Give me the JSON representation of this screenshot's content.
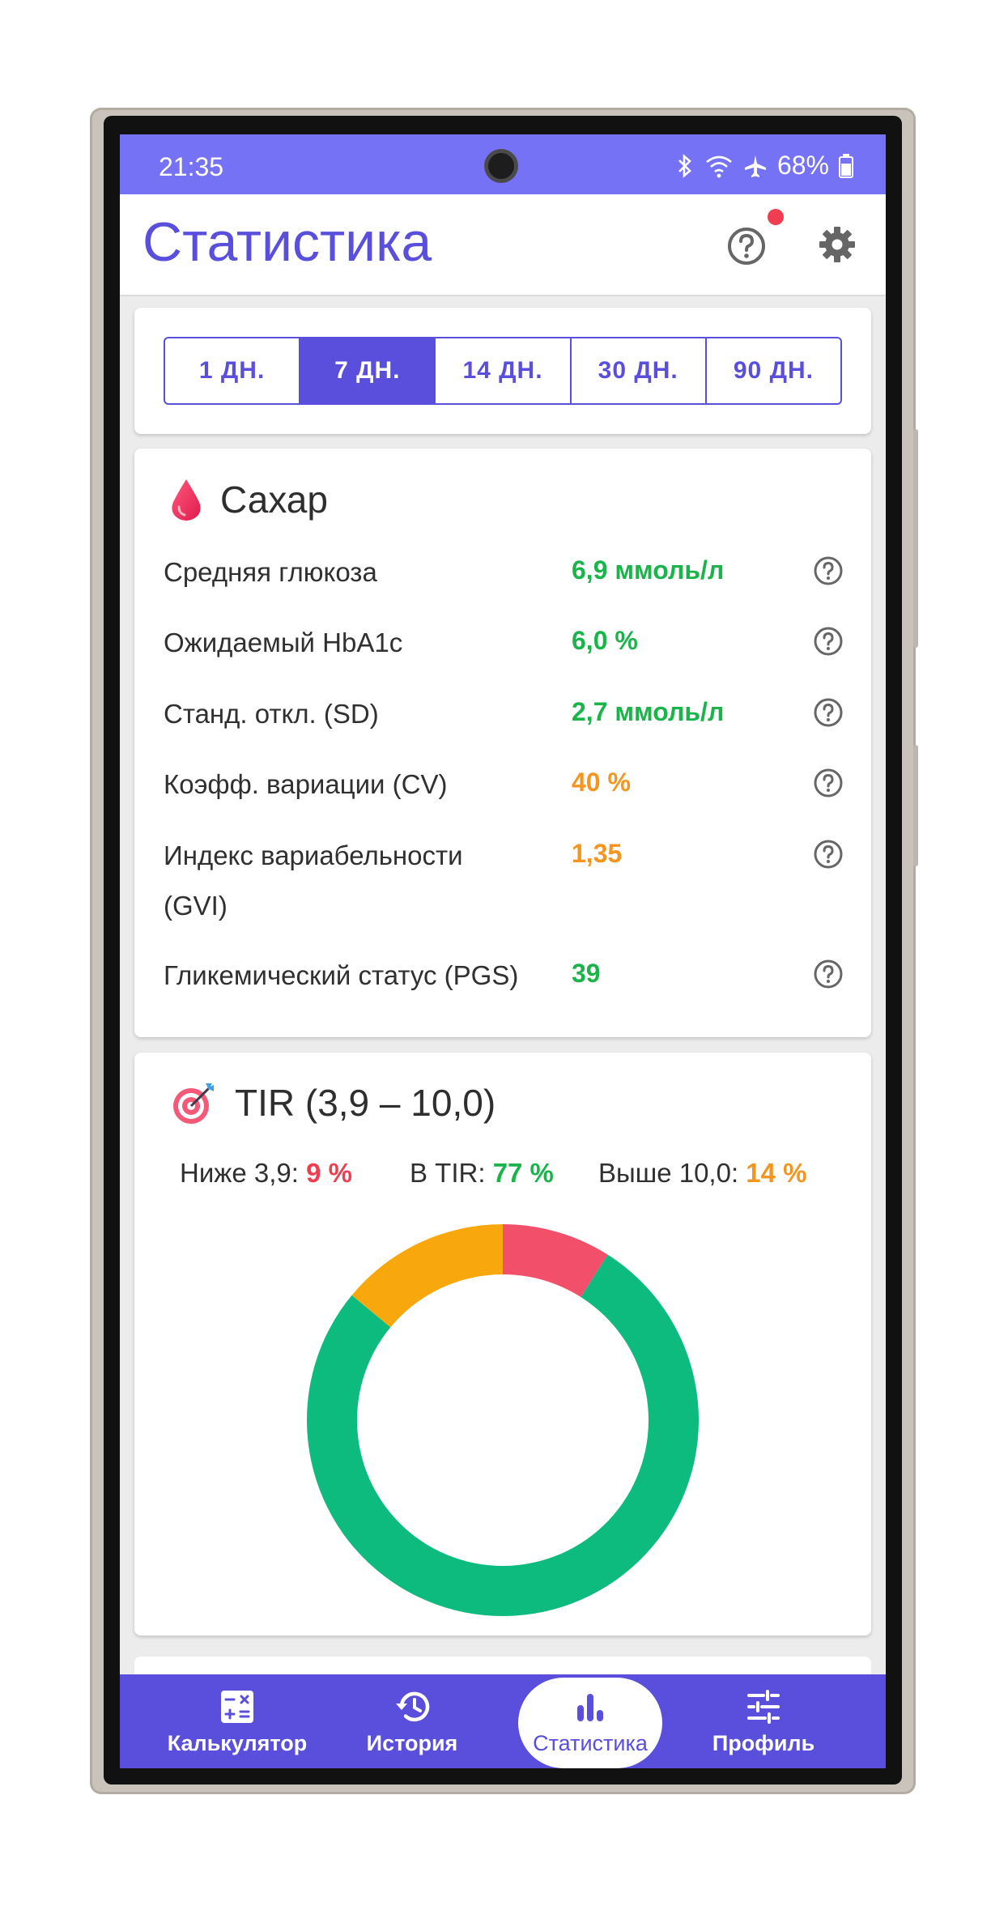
{
  "status_bar": {
    "time": "21:35",
    "battery": "68%",
    "icons": [
      "bluetooth-icon",
      "wifi-icon",
      "airplane-icon",
      "battery-icon"
    ]
  },
  "app_bar": {
    "title": "Статистика",
    "help_icon": "help-circle-icon",
    "settings_icon": "gear-icon"
  },
  "period_selector": {
    "options": [
      "1 ДН.",
      "7 ДН.",
      "14 ДН.",
      "30 ДН.",
      "90 ДН."
    ],
    "selected": "7 ДН."
  },
  "sugar": {
    "title": "Сахар",
    "icon": "blood-drop-icon",
    "stats": [
      {
        "label": "Средняя глюкоза",
        "value": "6,9 ммоль/л",
        "status": "good"
      },
      {
        "label": "Ожидаемый HbA1c",
        "value": "6,0 %",
        "status": "good"
      },
      {
        "label": "Станд. откл. (SD)",
        "value": "2,7 ммоль/л",
        "status": "good"
      },
      {
        "label": "Коэфф. вариации (CV)",
        "value": "40 %",
        "status": "warning"
      },
      {
        "label": "Индекс вариабельности (GVI)",
        "value": "1,35",
        "status": "warning"
      },
      {
        "label": "Гликемический статус (PGS)",
        "value": "39",
        "status": "good"
      }
    ]
  },
  "tir": {
    "title": "TIR (3,9 – 10,0)",
    "icon": "target-icon",
    "below": {
      "label": "Ниже 3,9:",
      "value": "9 %",
      "percent": 9,
      "color": "#f2506a"
    },
    "in_range": {
      "label": "В TIR:",
      "value": "77 %",
      "percent": 77,
      "color": "#0dbb7f"
    },
    "above": {
      "label": "Выше 10,0:",
      "value": "14 %",
      "percent": 14,
      "color": "#f8a70c"
    }
  },
  "bottom_nav": {
    "items": [
      {
        "label": "Калькулятор",
        "icon": "calculator-icon"
      },
      {
        "label": "История",
        "icon": "history-icon"
      },
      {
        "label": "Статистика",
        "icon": "bar-chart-icon"
      },
      {
        "label": "Профиль",
        "icon": "sliders-icon"
      }
    ],
    "active": "Статистика"
  },
  "colors": {
    "primary": "#5a4fdc",
    "status_bar": "#7672f6",
    "good": "#1bb44b",
    "warning": "#f3951f",
    "bad": "#ef3e4f"
  }
}
